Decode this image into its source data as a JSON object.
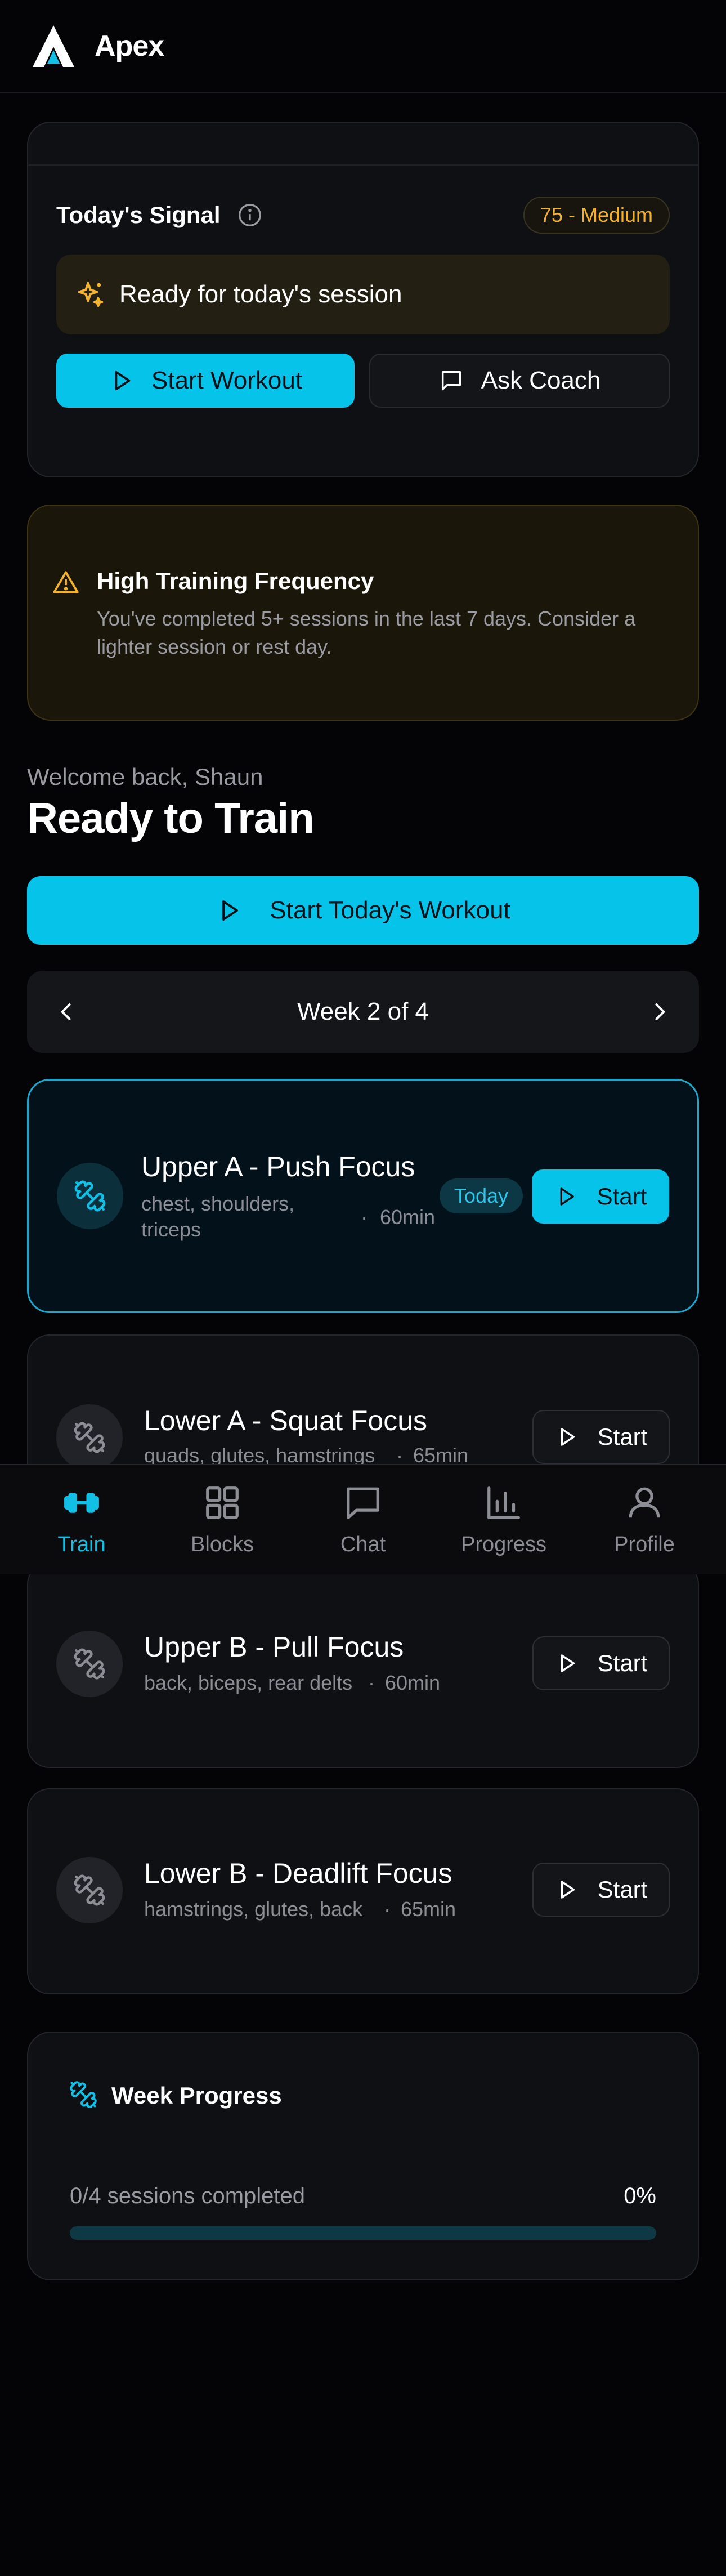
{
  "header": {
    "app_name": "Apex"
  },
  "signal": {
    "title": "Today's Signal",
    "badge": "75 - Medium",
    "status": "Ready for today's session",
    "start_label": "Start Workout",
    "coach_label": "Ask Coach"
  },
  "warning": {
    "title": "High Training Frequency",
    "body": "You've completed 5+ sessions in the last 7 days. Consider a lighter session or rest day."
  },
  "welcome": {
    "subtitle": "Welcome back, Shaun",
    "title": "Ready to Train",
    "start_today_label": "Start Today's Workout"
  },
  "week_nav": {
    "label": "Week 2 of 4"
  },
  "workouts": [
    {
      "title": "Upper A - Push Focus",
      "muscles": "chest, shoulders, triceps",
      "duration": "60min",
      "badge": "Today",
      "start_label": "Start"
    },
    {
      "title": "Lower A - Squat Focus",
      "muscles": "quads, glutes, hamstrings",
      "duration": "65min",
      "start_label": "Start"
    },
    {
      "title": "Upper B - Pull Focus",
      "muscles": "back, biceps, rear delts",
      "duration": "60min",
      "start_label": "Start"
    },
    {
      "title": "Lower B - Deadlift Focus",
      "muscles": "hamstrings, glutes, back",
      "duration": "65min",
      "start_label": "Start"
    }
  ],
  "week_progress": {
    "title": "Week Progress",
    "sessions": "0/4 sessions completed",
    "percent_label": "0%",
    "fraction": 0
  },
  "nav": {
    "items": [
      {
        "label": "Train",
        "icon": "dumbbell-icon",
        "active": true
      },
      {
        "label": "Blocks",
        "icon": "grid-icon",
        "active": false
      },
      {
        "label": "Chat",
        "icon": "chat-icon",
        "active": false
      },
      {
        "label": "Progress",
        "icon": "bar-chart-icon",
        "active": false
      },
      {
        "label": "Profile",
        "icon": "user-icon",
        "active": false
      }
    ]
  },
  "colors": {
    "accent": "#06c3ea",
    "warning": "#f5b32c",
    "background": "#040406"
  }
}
